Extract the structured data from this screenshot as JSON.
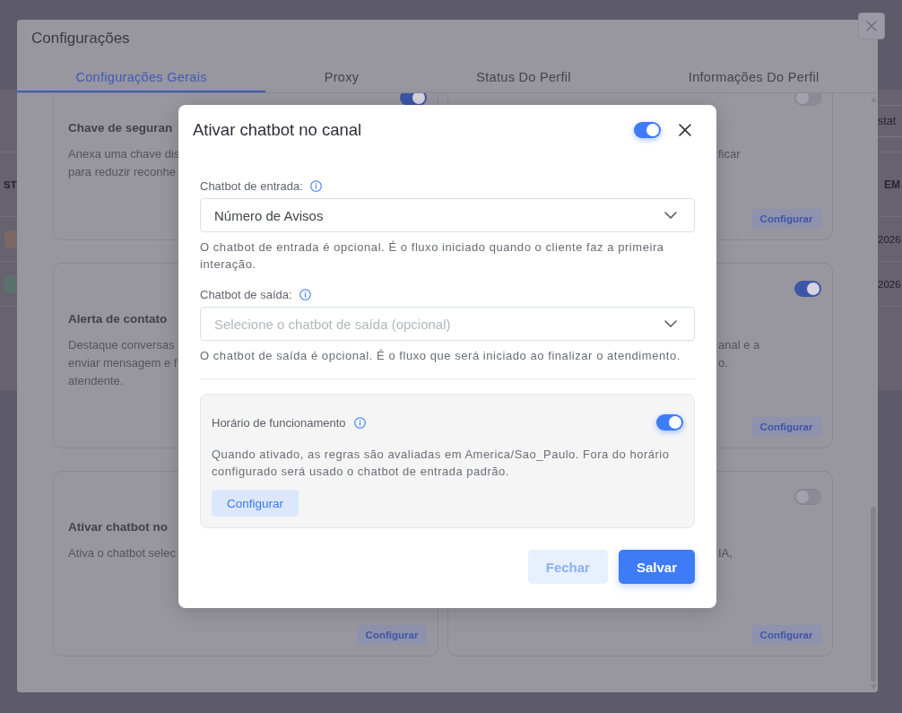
{
  "background_page": {
    "search": {
      "placeholder": "stat"
    },
    "table": {
      "columns": [
        "ST",
        "EM"
      ],
      "rows": [
        {
          "color": "#7c6767",
          "column_2": "2026"
        },
        {
          "color": "#5b716d",
          "column_2": "2026"
        }
      ]
    }
  },
  "settings_dialog": {
    "title": "Configurações",
    "tabs": [
      {
        "label": "Configurações Gerais",
        "selected": true
      },
      {
        "label": "Proxy",
        "selected": false
      },
      {
        "label": "Status Do Perfil",
        "selected": false
      },
      {
        "label": "Informações Do Perfil",
        "selected": false
      }
    ],
    "cards": [
      {
        "title": "Chave de seguran",
        "description_lines": [
          "Anexa uma chave dis",
          "para reduzir reconhe"
        ],
        "enabled": true
      },
      {
        "description_lines": [
          "ficar"
        ],
        "enabled": false,
        "button": "Configurar"
      },
      {
        "title": "Alerta de contato",
        "description_lines": [
          "Destaque conversas",
          "enviar mensagem e f",
          "atendente."
        ]
      },
      {
        "description_lines": [
          "anal e a",
          "o."
        ],
        "enabled": true,
        "button": "Configurar"
      },
      {
        "title": "Ativar chatbot no",
        "description_lines": [
          "Ativa o chatbot selec"
        ],
        "button": "Configurar"
      },
      {
        "description_lines": [
          "IA,"
        ],
        "enabled": false,
        "button": "Configurar"
      }
    ]
  },
  "chatbot_modal": {
    "title": "Ativar chatbot no canal",
    "enabled": true,
    "fields": [
      {
        "label": "Chatbot de entrada:",
        "value": "Número de Avisos",
        "help": "O chatbot de entrada é opcional. É o fluxo iniciado quando o cliente faz a primeira interação."
      },
      {
        "label": "Chatbot de saída:",
        "placeholder": "Selecione o chatbot de saída (opcional)",
        "help": "O chatbot de saída é opcional. É o fluxo que será iniciado ao finalizar o atendimento."
      }
    ],
    "schedule": {
      "label": "Horário de funcionamento",
      "enabled": true,
      "description": "Quando ativado, as regras são avaliadas em America/Sao_Paulo. Fora do horário configurado será usado o chatbot de entrada padrão.",
      "button": "Configurar"
    },
    "buttons": [
      {
        "label": "Fechar",
        "kind": "secondary"
      },
      {
        "label": "Salvar",
        "kind": "primary"
      }
    ]
  }
}
